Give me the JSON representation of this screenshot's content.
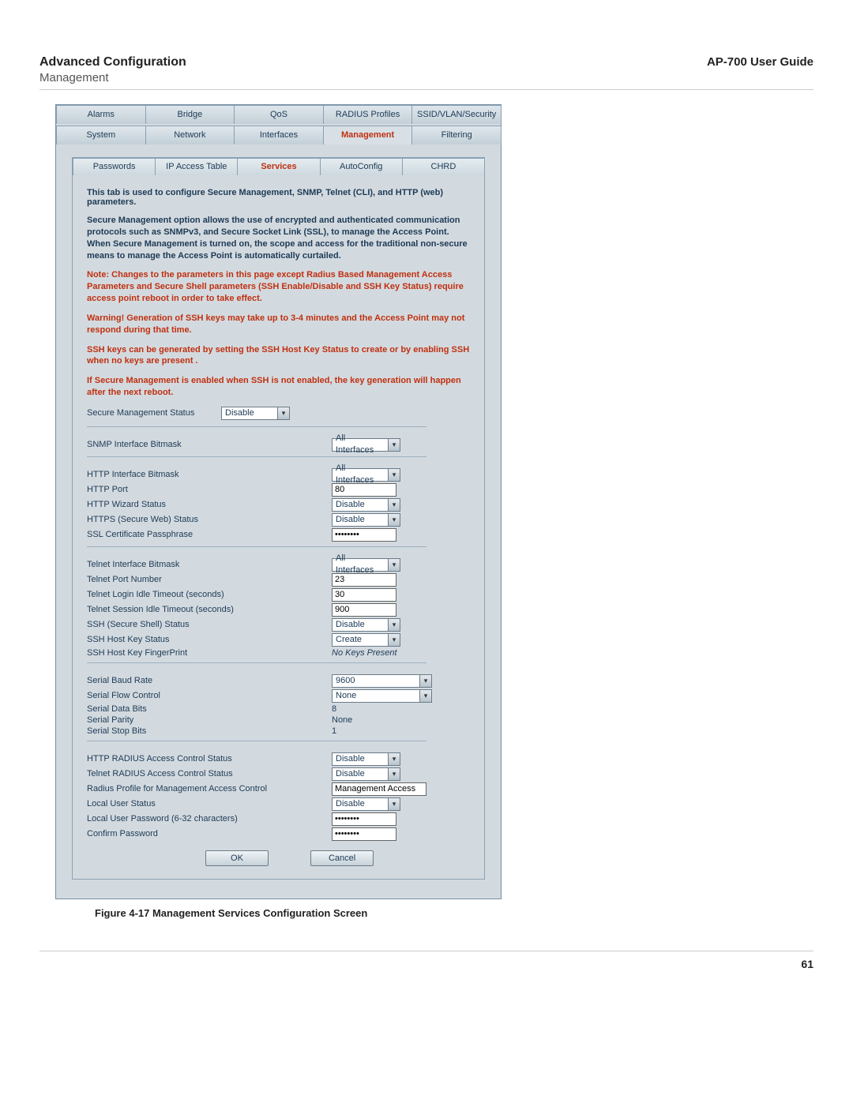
{
  "header": {
    "title": "Advanced Configuration",
    "subtitle": "Management",
    "guide": "AP-700 User Guide"
  },
  "tabs_top": [
    "Alarms",
    "Bridge",
    "QoS",
    "RADIUS Profiles",
    "SSID/VLAN/Security"
  ],
  "tabs_sub": [
    "System",
    "Network",
    "Interfaces",
    "Management",
    "Filtering"
  ],
  "active_sub": "Management",
  "subtabs": [
    "Passwords",
    "IP Access Table",
    "Services",
    "AutoConfig",
    "CHRD"
  ],
  "active_subtab": "Services",
  "text": {
    "intro": "This tab is used to configure Secure Management, SNMP, Telnet (CLI), and HTTP (web) parameters.",
    "para1": "Secure Management option allows the use of encrypted and authenticated communication protocols such as SNMPv3, and Secure Socket Link (SSL), to manage the Access Point. When Secure Management is turned on, the scope and access for the traditional non-secure means to manage the Access Point is automatically curtailed.",
    "note": "Note: Changes to the parameters in this page except Radius Based Management Access Parameters and Secure Shell parameters (SSH Enable/Disable and SSH Key Status) require access point reboot in order to take effect.",
    "warn1": "Warning! Generation of SSH keys may take up to 3-4 minutes and the Access Point may not respond during that time.",
    "warn2": "SSH keys can be generated by setting the SSH Host Key Status to create or by enabling SSH when no keys are present .",
    "warn3": "If Secure Management is enabled when SSH is not enabled, the key generation will happen after the next reboot."
  },
  "secure_mgmt": {
    "label": "Secure Management Status",
    "value": "Disable"
  },
  "snmp": {
    "bitmask_label": "SNMP Interface Bitmask",
    "bitmask_value": "All Interfaces"
  },
  "http": {
    "bitmask_label": "HTTP Interface Bitmask",
    "bitmask_value": "All Interfaces",
    "port_label": "HTTP Port",
    "port_value": "80",
    "wizard_label": "HTTP Wizard Status",
    "wizard_value": "Disable",
    "https_label": "HTTPS (Secure Web) Status",
    "https_value": "Disable",
    "ssl_label": "SSL Certificate Passphrase",
    "ssl_value": "********"
  },
  "telnet": {
    "bitmask_label": "Telnet Interface Bitmask",
    "bitmask_value": "All Interfaces",
    "port_label": "Telnet Port Number",
    "port_value": "23",
    "login_label": "Telnet Login Idle Timeout (seconds)",
    "login_value": "30",
    "session_label": "Telnet Session Idle Timeout (seconds)",
    "session_value": "900",
    "ssh_label": "SSH (Secure Shell) Status",
    "ssh_value": "Disable",
    "sshkey_label": "SSH Host Key Status",
    "sshkey_value": "Create",
    "fp_label": "SSH Host Key FingerPrint",
    "fp_value": "No Keys Present"
  },
  "serial": {
    "baud_label": "Serial Baud Rate",
    "baud_value": "9600",
    "flow_label": "Serial Flow Control",
    "flow_value": "None",
    "data_label": "Serial Data Bits",
    "data_value": "8",
    "parity_label": "Serial Parity",
    "parity_value": "None",
    "stop_label": "Serial Stop Bits",
    "stop_value": "1"
  },
  "radius": {
    "http_label": "HTTP RADIUS Access Control Status",
    "http_value": "Disable",
    "telnet_label": "Telnet RADIUS Access Control Status",
    "telnet_value": "Disable",
    "profile_label": "Radius Profile for Management Access Control",
    "profile_value": "Management Access",
    "local_label": "Local User Status",
    "local_value": "Disable",
    "pwd_label": "Local User Password (6-32 characters)",
    "pwd_value": "********",
    "confirm_label": "Confirm Password",
    "confirm_value": "********"
  },
  "buttons": {
    "ok": "OK",
    "cancel": "Cancel"
  },
  "caption": "Figure 4-17 Management Services Configuration Screen",
  "page_number": "61"
}
